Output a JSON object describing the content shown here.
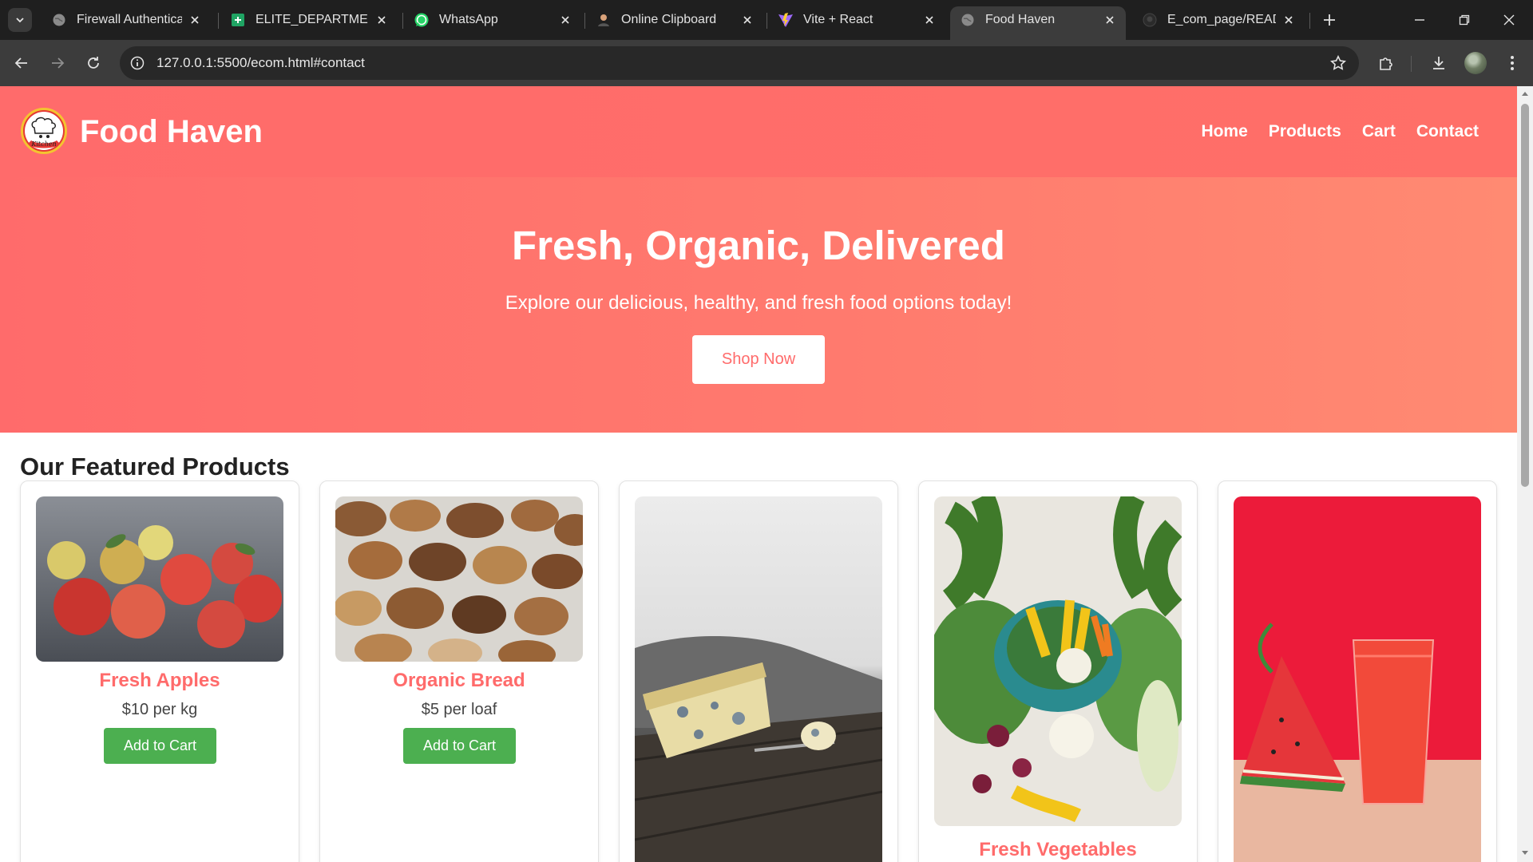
{
  "browser": {
    "tabs": [
      {
        "title": "Firewall Authenticatio",
        "icon": "globe-icon"
      },
      {
        "title": "ELITE_DEPARTMENTW",
        "icon": "sheets-icon"
      },
      {
        "title": "WhatsApp",
        "icon": "whatsapp-icon"
      },
      {
        "title": "Online Clipboard",
        "icon": "user-icon"
      },
      {
        "title": "Vite + React",
        "icon": "vite-icon"
      },
      {
        "title": "Food Haven",
        "icon": "globe-icon",
        "active": true
      },
      {
        "title": "E_com_page/READM",
        "icon": "github-icon"
      }
    ],
    "url": "127.0.0.1:5500/ecom.html#contact"
  },
  "site": {
    "brand": "Food Haven",
    "logo_text": "Kitchen",
    "nav": [
      "Home",
      "Products",
      "Cart",
      "Contact"
    ]
  },
  "hero": {
    "title": "Fresh, Organic, Delivered",
    "subtitle": "Explore our delicious, healthy, and fresh food options today!",
    "button": "Shop Now"
  },
  "featured": {
    "title": "Our Featured Products",
    "products": [
      {
        "name": "Fresh Apples",
        "price": "$10 per kg",
        "button": "Add to Cart",
        "image": "apples-photo"
      },
      {
        "name": "Organic Bread",
        "price": "$5 per loaf",
        "button": "Add to Cart",
        "image": "bread-photo"
      },
      {
        "name": "",
        "price": "",
        "button": "",
        "image": "cheese-photo"
      },
      {
        "name": "Fresh Vegetables",
        "price": "",
        "button": "",
        "image": "vegetables-photo"
      },
      {
        "name": "",
        "price": "",
        "button": "",
        "image": "watermelon-juice-photo"
      }
    ]
  },
  "colors": {
    "header": "#ff6b6b",
    "accent": "#ff6b6b",
    "add_button": "#4caf50",
    "chrome_dark": "#1f1f1f"
  }
}
